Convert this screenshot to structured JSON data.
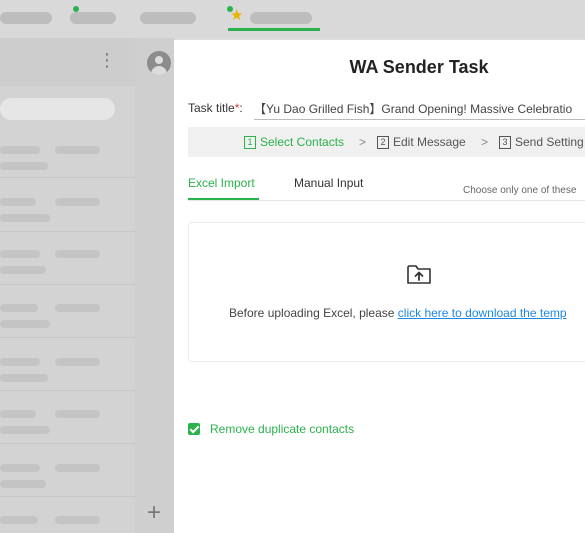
{
  "modal": {
    "title": "WA Sender Task",
    "task_title_label": "Task title",
    "task_title_required": "*",
    "task_title_colon": ":",
    "task_title_value": "【Yu Dao Grilled Fish】Grand Opening! Massive Celebratio",
    "steps": [
      {
        "num": "1",
        "label": "Select Contacts",
        "active": true
      },
      {
        "num": "2",
        "label": "Edit Message",
        "active": false
      },
      {
        "num": "3",
        "label": "Send Setting",
        "active": false
      }
    ],
    "step_separator": ">",
    "tabs": [
      {
        "label": "Excel Import",
        "active": true
      },
      {
        "label": "Manual Input",
        "active": false
      }
    ],
    "tab_hint": "Choose only one of these",
    "upload": {
      "text_before": "Before uploading Excel, please ",
      "link_text": "click here to download the temp",
      "icon": "upload-icon"
    },
    "dedup_label": "Remove duplicate contacts",
    "dedup_checked": true
  },
  "chat_panel": {
    "more_icon": "more-vertical-icon",
    "avatar_icon": "avatar-icon",
    "add_icon": "plus-icon"
  },
  "colors": {
    "accent": "#2bb24c",
    "link": "#1e88e5",
    "required": "#e53935"
  }
}
